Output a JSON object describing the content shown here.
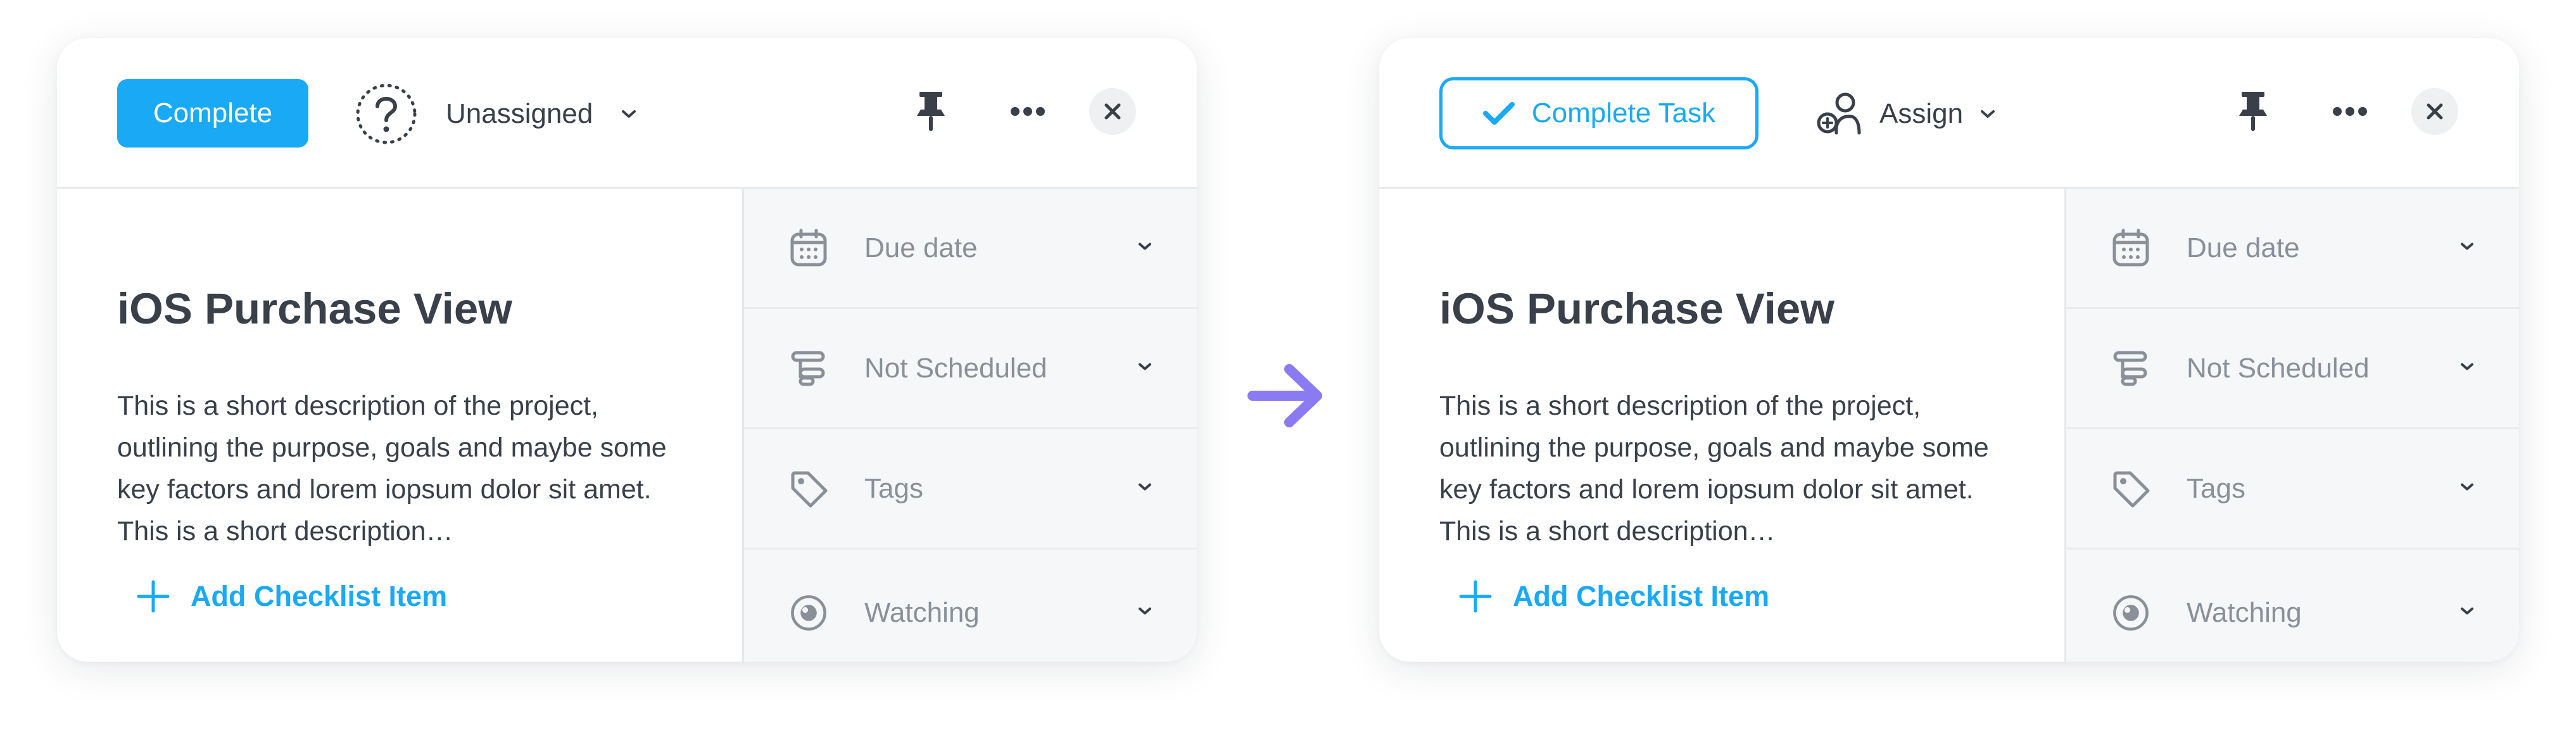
{
  "colors": {
    "accent": "#1aa9f5",
    "text": "#39404a",
    "muted": "#8a9099",
    "arrow": "#8a7bf2",
    "sidebar_bg": "#f6f7f8"
  },
  "before": {
    "complete_label": "Complete",
    "assignee_label": "Unassigned",
    "title": "iOS Purchase View",
    "description": "This is a short description of the project, outlining the purpose, goals and maybe some key factors and lorem iopsum dolor sit amet. This is a short description…",
    "add_checklist_label": "Add Checklist Item",
    "fields": [
      {
        "label": "Due date",
        "icon": "calendar-icon"
      },
      {
        "label": "Not Scheduled",
        "icon": "schedule-icon"
      },
      {
        "label": "Tags",
        "icon": "tag-icon"
      },
      {
        "label": "Watching",
        "icon": "eye-icon"
      }
    ]
  },
  "after": {
    "complete_label": "Complete Task",
    "assignee_label": "Assign",
    "title": "iOS Purchase View",
    "description": "This is a short description of the project, outlining the purpose, goals and maybe some key factors and lorem iopsum dolor sit amet. This is a short description…",
    "add_checklist_label": "Add Checklist Item",
    "fields": [
      {
        "label": "Due date",
        "icon": "calendar-icon"
      },
      {
        "label": "Not Scheduled",
        "icon": "schedule-icon"
      },
      {
        "label": "Tags",
        "icon": "tag-icon"
      },
      {
        "label": "Watching",
        "icon": "eye-icon"
      }
    ]
  }
}
